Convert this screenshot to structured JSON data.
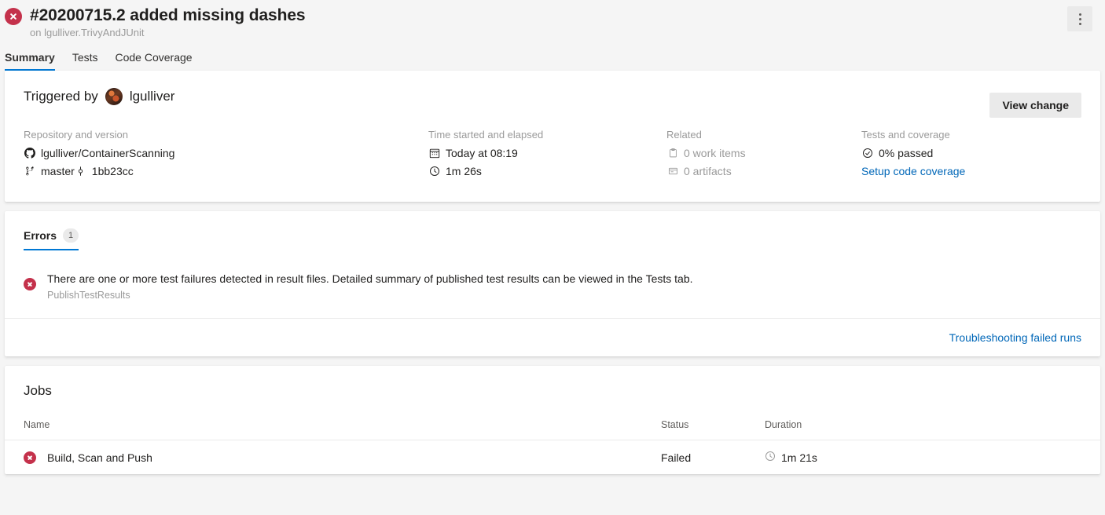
{
  "header": {
    "run_title": "#20200715.2 added missing dashes",
    "subtitle": "on lgulliver.TrivyAndJUnit",
    "status": "failed",
    "more_actions_label": "More actions",
    "tabs": [
      {
        "label": "Summary",
        "active": true
      },
      {
        "label": "Tests",
        "active": false
      },
      {
        "label": "Code Coverage",
        "active": false
      }
    ]
  },
  "summary": {
    "triggered_by_text": "Triggered by",
    "triggered_by_user": "lgulliver",
    "view_change_label": "View change",
    "repository": {
      "heading": "Repository and version",
      "repo": "lgulliver/ContainerScanning",
      "branch": "master",
      "commit": "1bb23cc"
    },
    "time": {
      "heading": "Time started and elapsed",
      "started": "Today at 08:19",
      "elapsed": "1m 26s"
    },
    "related": {
      "heading": "Related",
      "work_items": "0 work items",
      "artifacts": "0 artifacts"
    },
    "tests": {
      "heading": "Tests and coverage",
      "passed": "0% passed",
      "setup_link": "Setup code coverage"
    }
  },
  "errors": {
    "tab_label": "Errors",
    "count": "1",
    "items": [
      {
        "message": "There are one or more test failures detected in result files. Detailed summary of published test results can be viewed in the Tests tab.",
        "source": "PublishTestResults"
      }
    ],
    "troubleshooting_link": "Troubleshooting failed runs"
  },
  "jobs": {
    "title": "Jobs",
    "columns": [
      "Name",
      "Status",
      "Duration"
    ],
    "rows": [
      {
        "name": "Build, Scan and Push",
        "status": "Failed",
        "duration": "1m 21s"
      }
    ]
  },
  "colors": {
    "accent": "#0078d4",
    "link": "#0067b8",
    "error": "#c4314b",
    "page_bg": "#f5f5f5",
    "card_bg": "#ffffff",
    "muted_text": "#9a9a9a"
  }
}
